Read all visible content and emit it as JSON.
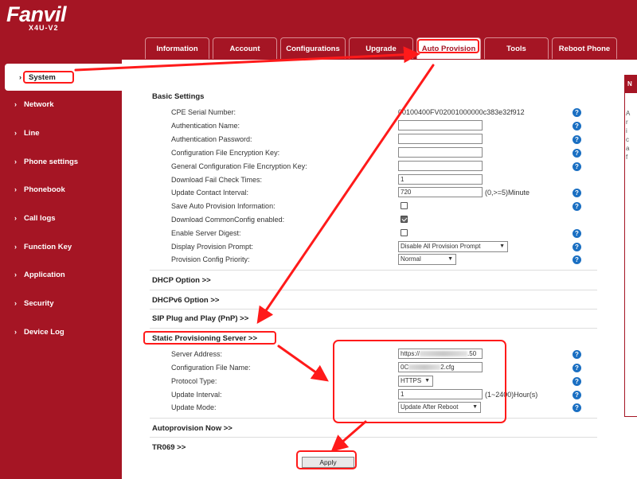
{
  "logo": {
    "brand": "Fanvil",
    "model": "X4U-V2"
  },
  "tabs": [
    {
      "label": "Information"
    },
    {
      "label": "Account"
    },
    {
      "label": "Configurations"
    },
    {
      "label": "Upgrade"
    },
    {
      "label": "Auto Provision"
    },
    {
      "label": "Tools"
    },
    {
      "label": "Reboot Phone"
    }
  ],
  "sidebar": {
    "items": [
      {
        "label": "System"
      },
      {
        "label": "Network"
      },
      {
        "label": "Line"
      },
      {
        "label": "Phone settings"
      },
      {
        "label": "Phonebook"
      },
      {
        "label": "Call logs"
      },
      {
        "label": "Function Key"
      },
      {
        "label": "Application"
      },
      {
        "label": "Security"
      },
      {
        "label": "Device Log"
      }
    ]
  },
  "basic": {
    "title": "Basic Settings",
    "cpe_label": "CPE Serial Number:",
    "cpe_value": "00100400FV02001000000c383e32f912",
    "auth_name_label": "Authentication Name:",
    "auth_name_value": "",
    "auth_pass_label": "Authentication Password:",
    "auth_pass_value": "",
    "cfg_key_label": "Configuration File Encryption Key:",
    "cfg_key_value": "",
    "gen_key_label": "General Configuration File Encryption Key:",
    "gen_key_value": "",
    "fail_label": "Download Fail Check Times:",
    "fail_value": "1",
    "contact_label": "Update Contact Interval:",
    "contact_value": "720",
    "contact_suffix": "(0,>=5)Minute",
    "save_label": "Save Auto Provision Information:",
    "save_checked": false,
    "common_label": "Download CommonConfig enabled:",
    "common_checked": true,
    "digest_label": "Enable Server Digest:",
    "digest_checked": false,
    "prompt_label": "Display Provision Prompt:",
    "prompt_value": "Disable All Provision Prompt",
    "priority_label": "Provision Config Priority:",
    "priority_value": "Normal"
  },
  "sections": {
    "dhcp": "DHCP Option >>",
    "dhcpv6": "DHCPv6 Option >>",
    "sip_pnp": "SIP Plug and Play (PnP) >>",
    "static": "Static Provisioning Server >>",
    "autoprov_now": "Autoprovision Now >>",
    "tr069": "TR069 >>"
  },
  "static": {
    "server_label": "Server Address:",
    "server_prefix": "https://",
    "server_suffix": ".50",
    "file_label": "Configuration File Name:",
    "file_prefix": "0C",
    "file_suffix": "2.cfg",
    "protocol_label": "Protocol Type:",
    "protocol_value": "HTTPS",
    "interval_label": "Update Interval:",
    "interval_value": "1",
    "interval_suffix": "(1~2400)Hour(s)",
    "mode_label": "Update Mode:",
    "mode_value": "Update After Reboot"
  },
  "apply_label": "Apply",
  "help_glyph": "?",
  "right_panel": {
    "head": "N",
    "chars": [
      "A",
      "r",
      "i",
      "c",
      "a",
      "f"
    ]
  },
  "colors": {
    "brand_red": "#a51524",
    "annotation_red": "#ff1a1a",
    "help_blue": "#1a6fc2"
  }
}
